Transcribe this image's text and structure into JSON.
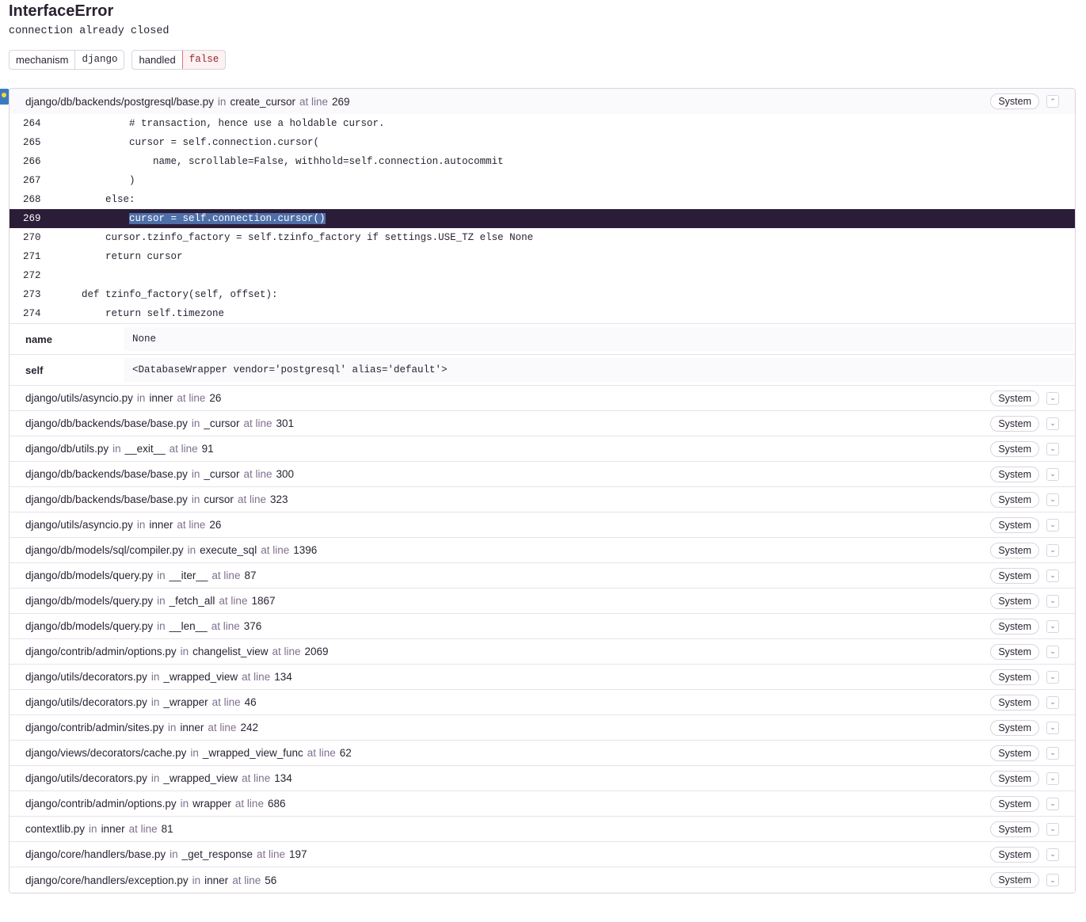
{
  "error": {
    "type": "InterfaceError",
    "value": "connection already closed"
  },
  "tags": [
    {
      "key": "mechanism",
      "value": "django"
    },
    {
      "key": "handled",
      "value": "false"
    }
  ],
  "labels": {
    "in": "in",
    "at_line": "at line",
    "system": "System"
  },
  "expanded_frame": {
    "file": "django/db/backends/postgresql/base.py",
    "function": "create_cursor",
    "line": "269",
    "code": [
      {
        "num": "264",
        "src": "        # transaction, hence use a holdable cursor."
      },
      {
        "num": "265",
        "src": "        cursor = self.connection.cursor("
      },
      {
        "num": "266",
        "src": "            name, scrollable=False, withhold=self.connection.autocommit"
      },
      {
        "num": "267",
        "src": "        )"
      },
      {
        "num": "268",
        "src": "    else:"
      },
      {
        "num": "269",
        "src": "cursor = self.connection.cursor()",
        "indent": "        ",
        "active": true
      },
      {
        "num": "270",
        "src": "    cursor.tzinfo_factory = self.tzinfo_factory if settings.USE_TZ else None"
      },
      {
        "num": "271",
        "src": "    return cursor"
      },
      {
        "num": "272",
        "src": ""
      },
      {
        "num": "273",
        "src": "def tzinfo_factory(self, offset):"
      },
      {
        "num": "274",
        "src": "    return self.timezone"
      }
    ],
    "vars": [
      {
        "key": "name",
        "value": "None"
      },
      {
        "key": "self",
        "value": "<DatabaseWrapper vendor='postgresql' alias='default'>"
      }
    ]
  },
  "frames": [
    {
      "file": "django/utils/asyncio.py",
      "function": "inner",
      "line": "26"
    },
    {
      "file": "django/db/backends/base/base.py",
      "function": "_cursor",
      "line": "301"
    },
    {
      "file": "django/db/utils.py",
      "function": "__exit__",
      "line": "91"
    },
    {
      "file": "django/db/backends/base/base.py",
      "function": "_cursor",
      "line": "300"
    },
    {
      "file": "django/db/backends/base/base.py",
      "function": "cursor",
      "line": "323"
    },
    {
      "file": "django/utils/asyncio.py",
      "function": "inner",
      "line": "26"
    },
    {
      "file": "django/db/models/sql/compiler.py",
      "function": "execute_sql",
      "line": "1396"
    },
    {
      "file": "django/db/models/query.py",
      "function": "__iter__",
      "line": "87"
    },
    {
      "file": "django/db/models/query.py",
      "function": "_fetch_all",
      "line": "1867"
    },
    {
      "file": "django/db/models/query.py",
      "function": "__len__",
      "line": "376"
    },
    {
      "file": "django/contrib/admin/options.py",
      "function": "changelist_view",
      "line": "2069"
    },
    {
      "file": "django/utils/decorators.py",
      "function": "_wrapped_view",
      "line": "134"
    },
    {
      "file": "django/utils/decorators.py",
      "function": "_wrapper",
      "line": "46"
    },
    {
      "file": "django/contrib/admin/sites.py",
      "function": "inner",
      "line": "242"
    },
    {
      "file": "django/views/decorators/cache.py",
      "function": "_wrapped_view_func",
      "line": "62"
    },
    {
      "file": "django/utils/decorators.py",
      "function": "_wrapped_view",
      "line": "134"
    },
    {
      "file": "django/contrib/admin/options.py",
      "function": "wrapper",
      "line": "686"
    },
    {
      "file": "contextlib.py",
      "function": "inner",
      "line": "81"
    },
    {
      "file": "django/core/handlers/base.py",
      "function": "_get_response",
      "line": "197"
    },
    {
      "file": "django/core/handlers/exception.py",
      "function": "inner",
      "line": "56"
    }
  ]
}
